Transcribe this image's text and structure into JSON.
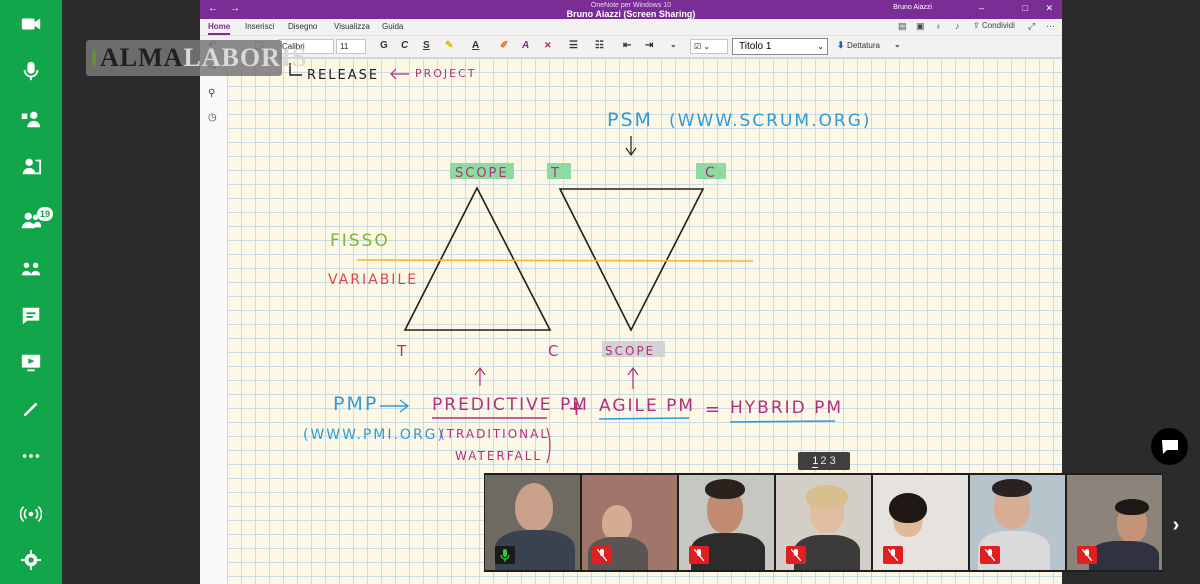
{
  "colors": {
    "rail": "#12a64a",
    "onenote_purple": "#7a2e95",
    "ink_black": "#1e1e1e",
    "ink_magenta": "#b0307f",
    "ink_blue": "#2e9bd6",
    "ink_green": "#7ab83d",
    "ink_red": "#e0454f",
    "ink_orange": "#f0b73a",
    "highlight_green": "#8ddba0",
    "highlight_grey": "#d3d3d3"
  },
  "rail": {
    "items": [
      {
        "name": "camera-icon"
      },
      {
        "name": "microphone-icon"
      },
      {
        "name": "assign-users-icon"
      },
      {
        "name": "user-card-icon"
      },
      {
        "name": "participants-icon",
        "badge": "19"
      },
      {
        "name": "breakout-rooms-icon"
      },
      {
        "name": "chat-icon"
      },
      {
        "name": "screen-share-icon"
      },
      {
        "name": "pen-icon"
      },
      {
        "name": "more-icon"
      },
      {
        "name": "broadcast-icon"
      },
      {
        "name": "settings-icon"
      }
    ]
  },
  "logo": {
    "text_dark": "ALMA",
    "text_light": "LABORIS"
  },
  "window": {
    "app_title": "OneNote per Windows 10",
    "sharing_title": "Bruno Aiazzi (Screen Sharing)",
    "user": "Bruno Aiazzi"
  },
  "tabs": [
    "Home",
    "Inserisci",
    "Disegno",
    "Visualizza",
    "Guida"
  ],
  "tab_actions": {
    "share_label": "Condividi"
  },
  "ribbon": {
    "font_name": "Calibri",
    "font_size": "11",
    "style": "Titolo 1",
    "dictation": "Dettatura"
  },
  "ink": {
    "release": "RELEASE",
    "project": "PROJECT",
    "psm": "PSM",
    "psm_url": "(WWW.SCRUM.ORG)",
    "scope_left": "SCOPE",
    "t_right": "T",
    "c_right": "C",
    "fisso": "FISSO",
    "variabile": "VARIABILE",
    "t_left": "T",
    "c_left": "C",
    "scope_right": "SCOPE",
    "pmp": "PMP",
    "pmi_url": "(WWW.PMI.ORG)",
    "predictive": "PREDICTIVE PM",
    "traditional": "(TRADITIONAL",
    "waterfall": "WATERFALL",
    "plus": "+",
    "agile": "AGILE PM",
    "equals": "=",
    "hybrid": "HYBRID PM"
  },
  "page_indicator": {
    "current": "1",
    "others": "2 3"
  },
  "participants": [
    {
      "name": "participant-1",
      "mic": "on"
    },
    {
      "name": "participant-2",
      "mic": "off"
    },
    {
      "name": "participant-3",
      "mic": "off"
    },
    {
      "name": "participant-4",
      "mic": "off"
    },
    {
      "name": "participant-5",
      "mic": "off"
    },
    {
      "name": "participant-6",
      "mic": "off"
    },
    {
      "name": "participant-7",
      "mic": "off"
    }
  ]
}
